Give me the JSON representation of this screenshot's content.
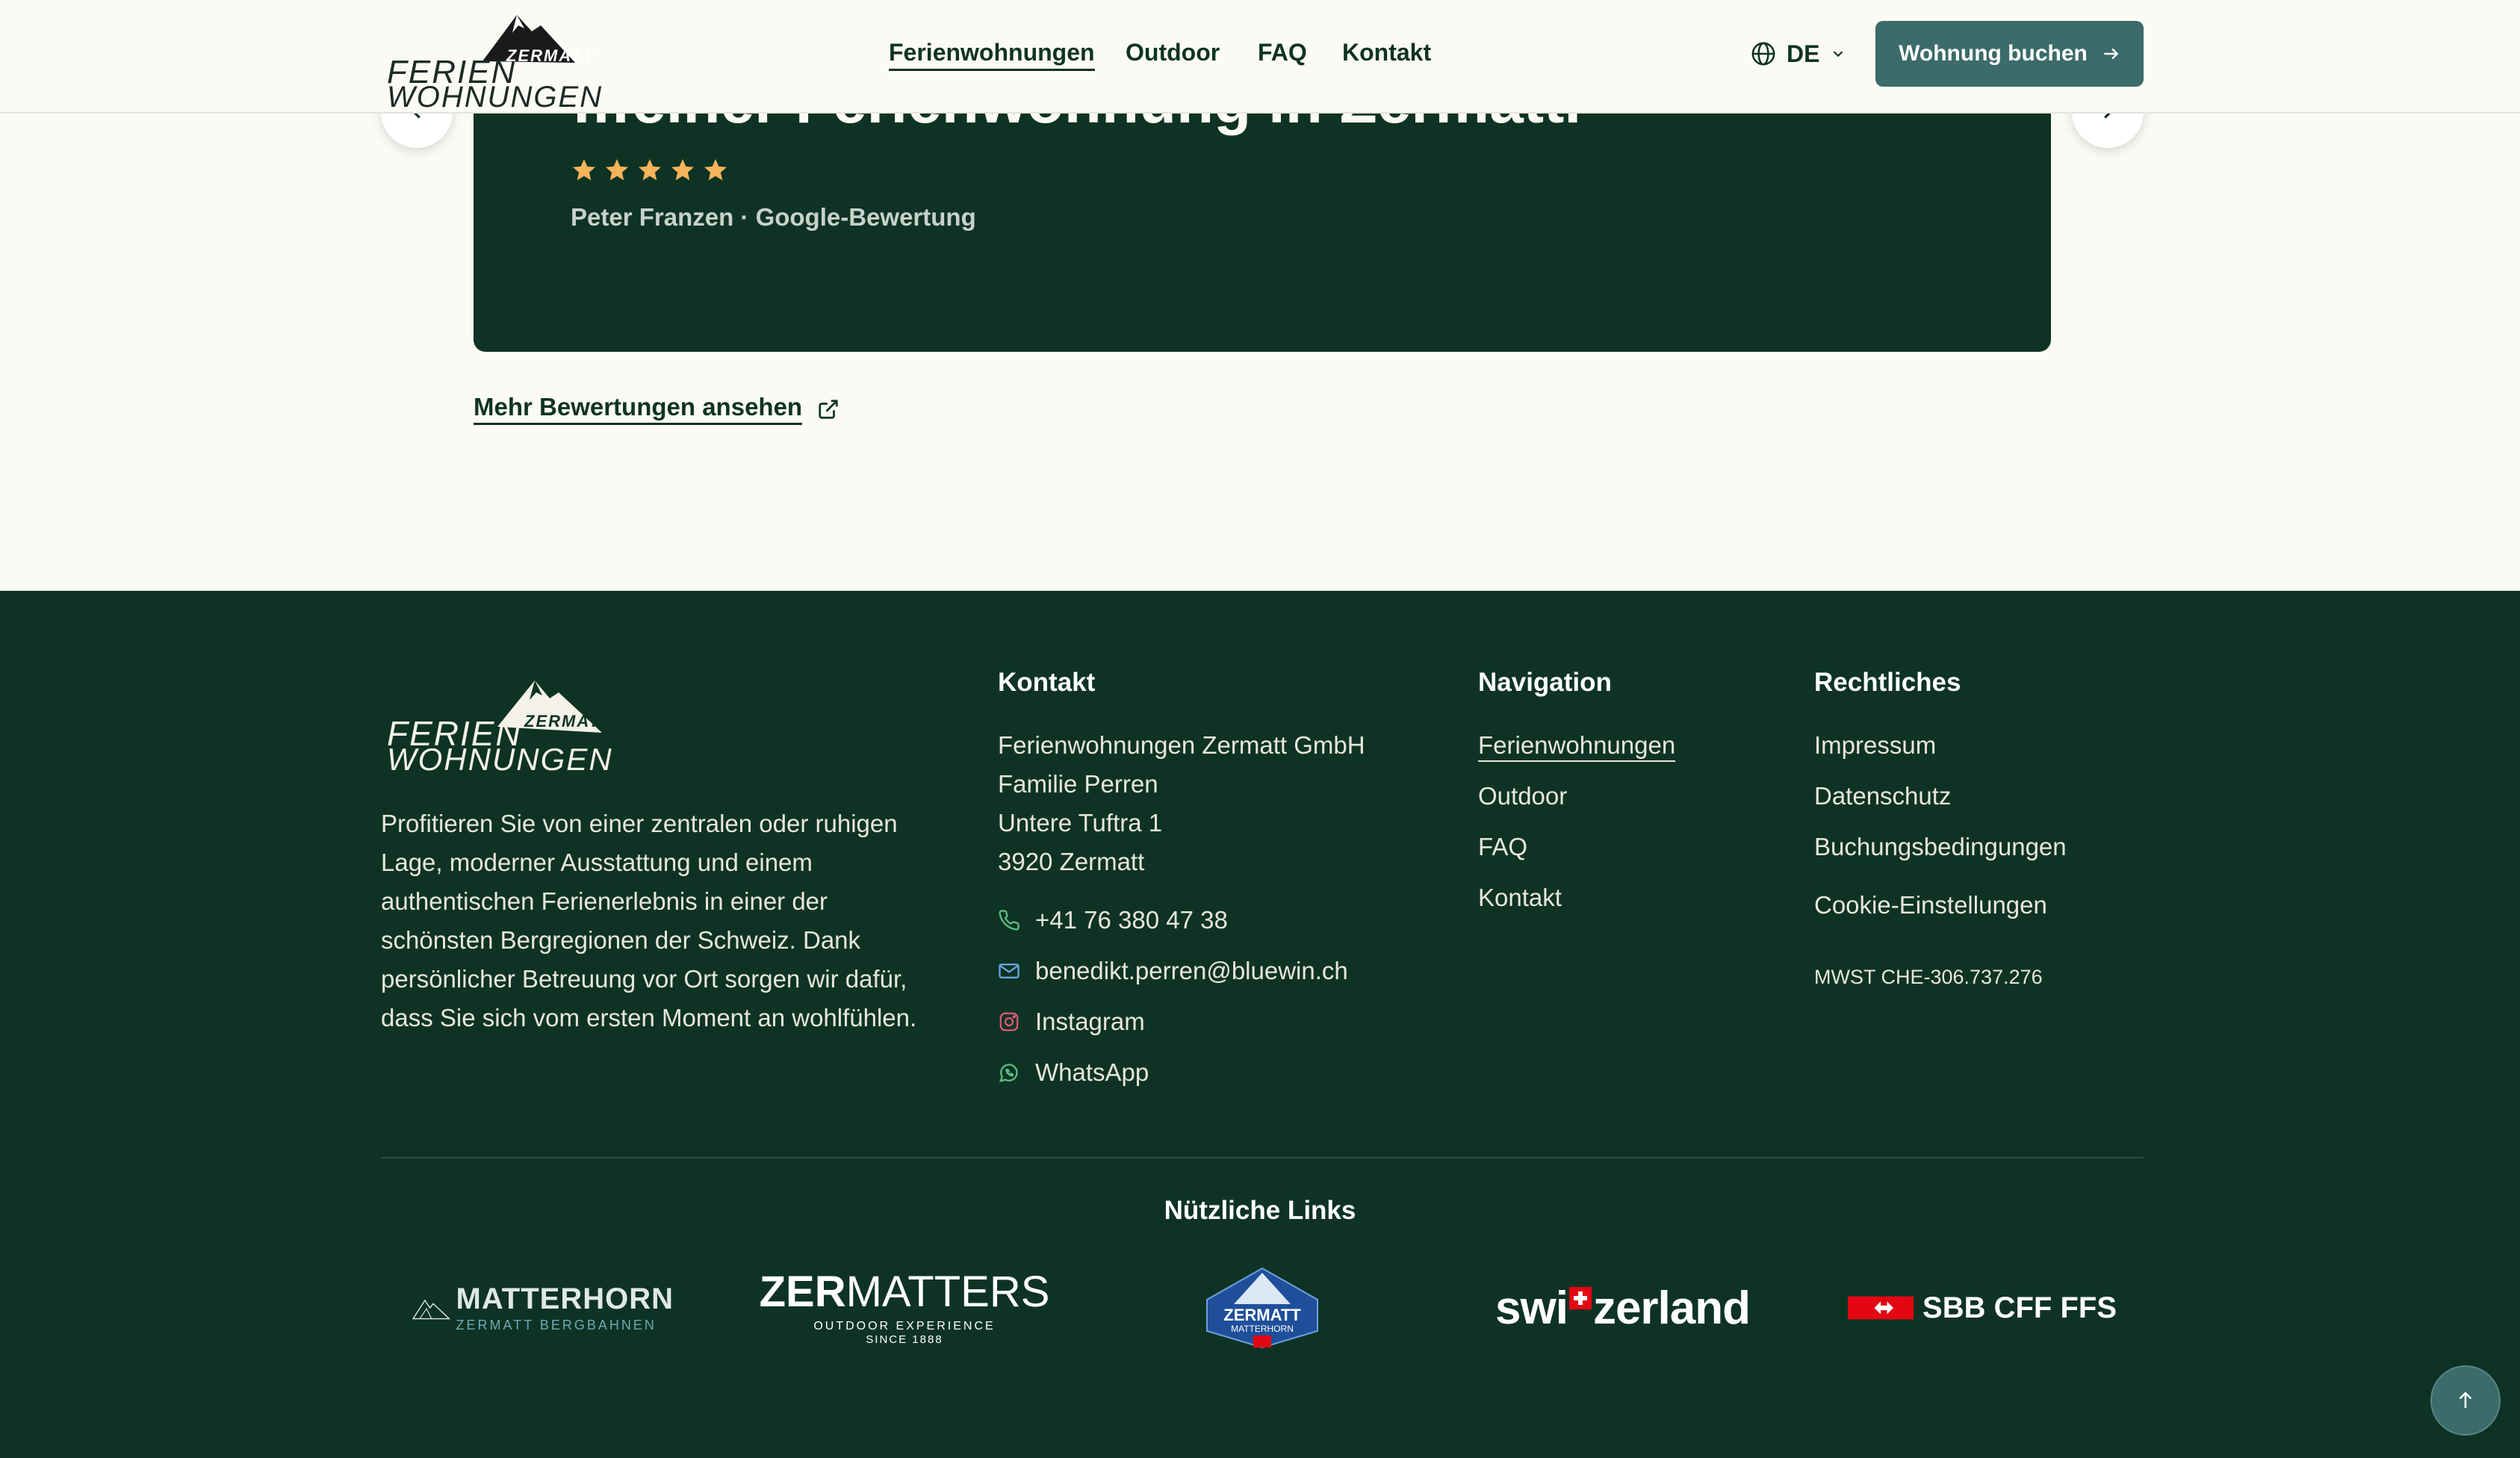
{
  "header": {
    "logo": {
      "line1": "FERIEN",
      "line2": "WOHNUNGEN",
      "badge": "ZERMATT"
    },
    "nav": [
      "Ferienwohnungen",
      "Outdoor",
      "FAQ",
      "Kontakt"
    ],
    "language": "DE",
    "book_button": "Wohnung buchen",
    "icons": {
      "globe": "globe-icon",
      "chevron": "chevron-down-icon",
      "arrow": "arrow-right-icon"
    }
  },
  "review": {
    "partial_heading": "…einer Ferienwohnung in Zermatt.",
    "rating_stars": 5,
    "author": "Peter Franzen · Google-Bewertung",
    "star_color": "#f5b35a"
  },
  "more_reviews": "Mehr Bewertungen ansehen",
  "footer": {
    "logo": {
      "line1": "FERIEN",
      "line2": "WOHNUNGEN",
      "badge": "ZERMATT"
    },
    "about": "Profitieren Sie von einer zentralen oder ruhigen Lage, moderner Ausstattung und einem authentischen Ferienerlebnis in einer der schönsten Bergregionen der Schweiz. Dank persönlicher Betreuung vor Ort sorgen wir dafür, dass Sie sich vom ersten Moment an wohlfühlen.",
    "kontakt": {
      "title": "Kontakt",
      "address": [
        "Ferienwohnungen Zermatt GmbH",
        "Familie Perren",
        "Untere Tuftra 1",
        "3920 Zermatt"
      ],
      "phone": "+41 76 380 47 38",
      "email": "benedikt.perren@bluewin.ch",
      "instagram": "Instagram",
      "whatsapp": "WhatsApp"
    },
    "navigation": {
      "title": "Navigation",
      "links": [
        "Ferienwohnungen",
        "Outdoor",
        "FAQ",
        "Kontakt"
      ]
    },
    "rechtliches": {
      "title": "Rechtliches",
      "links": [
        "Impressum",
        "Datenschutz",
        "Buchungsbedingungen",
        "Cookie-Einstellungen"
      ],
      "vat": "MWST CHE-306.737.276"
    },
    "useful_links_title": "Nützliche Links",
    "partners": {
      "matterhorn": {
        "name": "MATTERHORN",
        "sub": "ZERMATT BERGBAHNEN"
      },
      "zermatters": {
        "name_bold": "ZER",
        "name_light": "MATTERS",
        "sub1": "OUTDOOR EXPERIENCE",
        "sub2": "SINCE 1888"
      },
      "zermatt_badge": {
        "name": "ZERMATT",
        "sub": "MATTERHORN"
      },
      "switzerland": {
        "pre": "swi",
        "post": "zerland"
      },
      "sbb": "SBB CFF FFS"
    }
  },
  "colors": {
    "dark_green": "#0e3324",
    "teal": "#3b6b6a",
    "cream": "#fbfaf4",
    "swiss_red": "#e30613"
  }
}
